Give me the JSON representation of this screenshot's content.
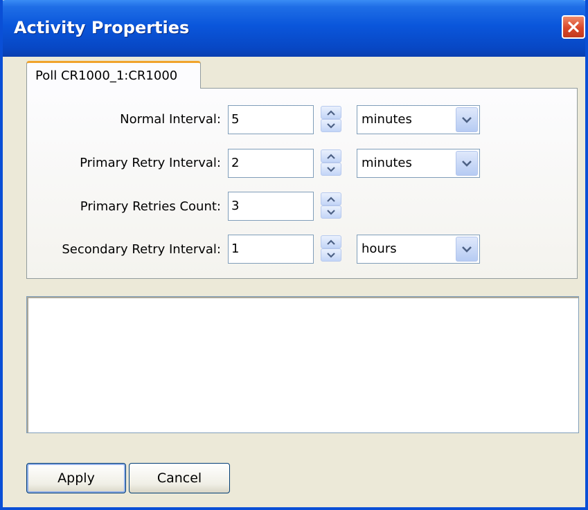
{
  "window": {
    "title": "Activity Properties"
  },
  "tab": {
    "label": "Poll CR1000_1:CR1000"
  },
  "fields": {
    "normal_interval": {
      "label": "Normal Interval:",
      "value": "5",
      "unit": "minutes"
    },
    "primary_retry_interval": {
      "label": "Primary Retry Interval:",
      "value": "2",
      "unit": "minutes"
    },
    "primary_retries_count": {
      "label": "Primary Retries Count:",
      "value": "3"
    },
    "secondary_retry_interval": {
      "label": "Secondary Retry Interval:",
      "value": "1",
      "unit": "hours"
    }
  },
  "buttons": {
    "apply": "Apply",
    "cancel": "Cancel"
  },
  "icons": {
    "close": "close-icon",
    "spin_up": "chevron-up-icon",
    "spin_down": "chevron-down-icon",
    "dropdown": "chevron-down-icon"
  },
  "colors": {
    "titlebar": "#0a56db",
    "window_bg": "#ece9d8",
    "close_button": "#d9472a",
    "tab_highlight": "#f0a32b"
  }
}
